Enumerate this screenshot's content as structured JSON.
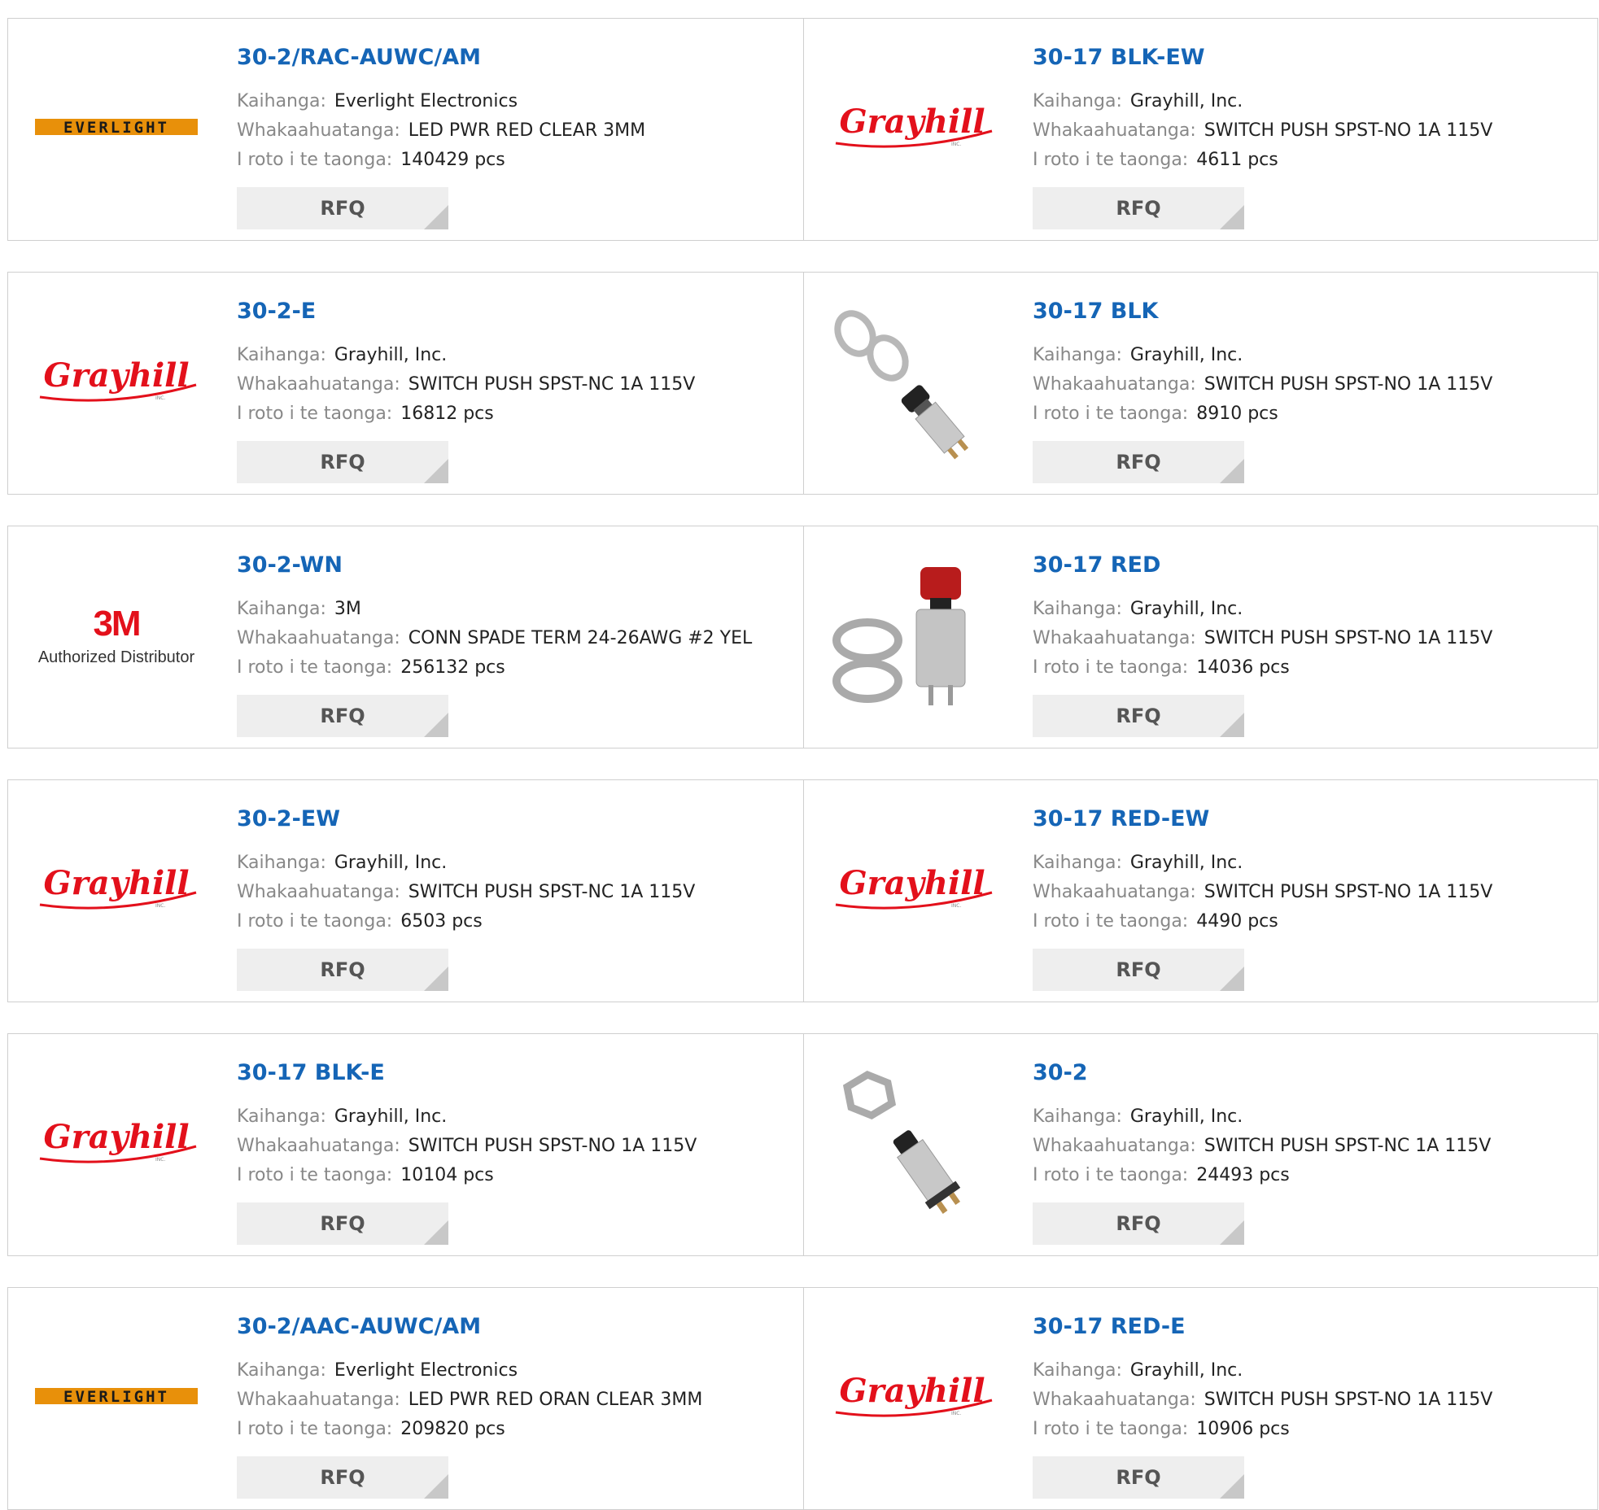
{
  "labels": {
    "manufacturer": "Kaihanga:",
    "description": "Whakaahuatanga:",
    "stock": "I roto i te taonga:",
    "rfq": "RFQ"
  },
  "logos": {
    "everlight": "EVERLIGHT",
    "grayhill": "Grayhill",
    "grayhill_sub": "INC.",
    "m3_big": "3M",
    "m3_sub": "Authorized Distributor"
  },
  "products": [
    {
      "pn": "30-2/RAC-AUWC/AM",
      "mfr": "Everlight Electronics",
      "desc": "LED PWR RED CLEAR 3MM",
      "stock": "140429 pcs",
      "logo": "everlight-logo"
    },
    {
      "pn": "30-17 BLK-EW",
      "mfr": "Grayhill, Inc.",
      "desc": "SWITCH PUSH SPST-NO 1A 115V",
      "stock": "4611 pcs",
      "logo": "grayhill-logo"
    },
    {
      "pn": "30-2-E",
      "mfr": "Grayhill, Inc.",
      "desc": "SWITCH PUSH SPST-NC 1A 115V",
      "stock": "16812 pcs",
      "logo": "grayhill-logo"
    },
    {
      "pn": "30-17 BLK",
      "mfr": "Grayhill, Inc.",
      "desc": "SWITCH PUSH SPST-NO 1A 115V",
      "stock": "8910 pcs",
      "logo": "switch-black-photo"
    },
    {
      "pn": "30-2-WN",
      "mfr": "3M",
      "desc": "CONN SPADE TERM 24-26AWG #2 YEL",
      "stock": "256132 pcs",
      "logo": "3m-logo"
    },
    {
      "pn": "30-17 RED",
      "mfr": "Grayhill, Inc.",
      "desc": "SWITCH PUSH SPST-NO 1A 115V",
      "stock": "14036 pcs",
      "logo": "switch-red-photo"
    },
    {
      "pn": "30-2-EW",
      "mfr": "Grayhill, Inc.",
      "desc": "SWITCH PUSH SPST-NC 1A 115V",
      "stock": "6503 pcs",
      "logo": "grayhill-logo"
    },
    {
      "pn": "30-17 RED-EW",
      "mfr": "Grayhill, Inc.",
      "desc": "SWITCH PUSH SPST-NO 1A 115V",
      "stock": "4490 pcs",
      "logo": "grayhill-logo"
    },
    {
      "pn": "30-17 BLK-E",
      "mfr": "Grayhill, Inc.",
      "desc": "SWITCH PUSH SPST-NO 1A 115V",
      "stock": "10104 pcs",
      "logo": "grayhill-logo"
    },
    {
      "pn": "30-2",
      "mfr": "Grayhill, Inc.",
      "desc": "SWITCH PUSH SPST-NC 1A 115V",
      "stock": "24493 pcs",
      "logo": "switch-silver-photo"
    },
    {
      "pn": "30-2/AAC-AUWC/AM",
      "mfr": "Everlight Electronics",
      "desc": "LED PWR RED ORAN CLEAR 3MM",
      "stock": "209820 pcs",
      "logo": "everlight-logo"
    },
    {
      "pn": "30-17 RED-E",
      "mfr": "Grayhill, Inc.",
      "desc": "SWITCH PUSH SPST-NO 1A 115V",
      "stock": "10906 pcs",
      "logo": "grayhill-logo"
    }
  ],
  "colors": {
    "link": "#1565b6",
    "grayhill_red": "#e3101b",
    "everlight_orange": "#e8900a"
  }
}
